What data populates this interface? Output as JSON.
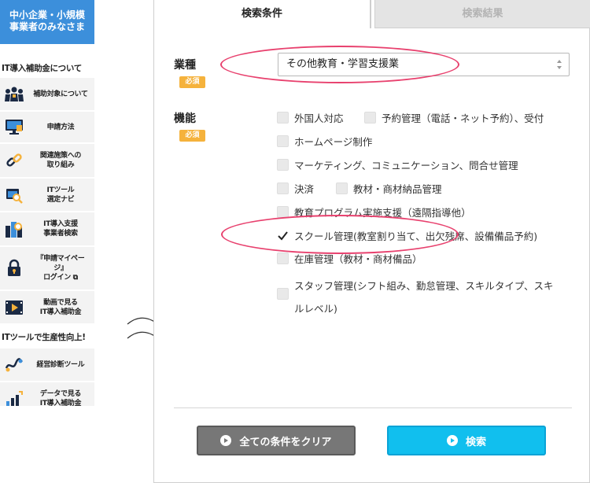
{
  "sidebar": {
    "header": [
      "中小企業・小規模",
      "事業者のみなさま"
    ],
    "section1": "IT導入補助金について",
    "section2": "ITツールで生産性向上!",
    "items": [
      {
        "icon": "people-icon",
        "label": [
          "補助対象について"
        ]
      },
      {
        "icon": "monitor-icon",
        "label": [
          "申請方法"
        ]
      },
      {
        "icon": "link-icon",
        "label": [
          "関連施策への",
          "取り組み"
        ]
      },
      {
        "icon": "tool-search-icon",
        "label": [
          "ITツール",
          "選定ナビ"
        ]
      },
      {
        "icon": "buildings-search-icon",
        "label": [
          "IT導入支援",
          "事業者検索"
        ]
      },
      {
        "icon": "lock-icon",
        "label": [
          "『申請マイペー",
          "ジ』",
          "ログイン ⧉"
        ]
      },
      {
        "icon": "video-icon",
        "label": [
          "動画で見る",
          "IT導入補助金"
        ]
      },
      {
        "icon": "diagnosis-icon",
        "label": [
          "経営診断ツール"
        ]
      },
      {
        "icon": "data-chart-icon",
        "label": [
          "データで見る",
          "IT導入補助金"
        ]
      }
    ]
  },
  "tabs": {
    "active": "検索条件",
    "inactive": "検索結果"
  },
  "form": {
    "industry_label": "業種",
    "function_label": "機能",
    "required_badge": "必須",
    "industry_value": "その他教育・学習支援業",
    "checkboxes": [
      {
        "label": "外国人対応",
        "checked": false
      },
      {
        "label": "予約管理（電話・ネット予約）、受付",
        "checked": false
      },
      {
        "label": "ホームページ制作",
        "checked": false
      },
      {
        "label": "マーケティング、コミュニケーション、問合せ管理",
        "checked": false
      },
      {
        "label": "決済",
        "checked": false
      },
      {
        "label": "教材・商材納品管理",
        "checked": false
      },
      {
        "label": "教育プログラム実施支援（遠隔指導他）",
        "checked": false
      },
      {
        "label": "スクール管理(教室割り当て、出欠残席、設備備品予約)",
        "checked": true
      },
      {
        "label": "在庫管理（教材・商材備品）",
        "checked": false
      },
      {
        "label": "スタッフ管理(シフト組み、勤怠管理、スキルタイプ、スキ",
        "checked": false
      },
      {
        "label": "ルレベル)",
        "checked": false
      }
    ]
  },
  "buttons": {
    "clear": "全ての条件をクリア",
    "search": "検索"
  },
  "colors": {
    "header_blue": "#3c8fdb",
    "badge_orange": "#f5b23c",
    "highlight_pink": "#e8416e",
    "search_cyan": "#11bfee",
    "clear_gray": "#777777"
  }
}
